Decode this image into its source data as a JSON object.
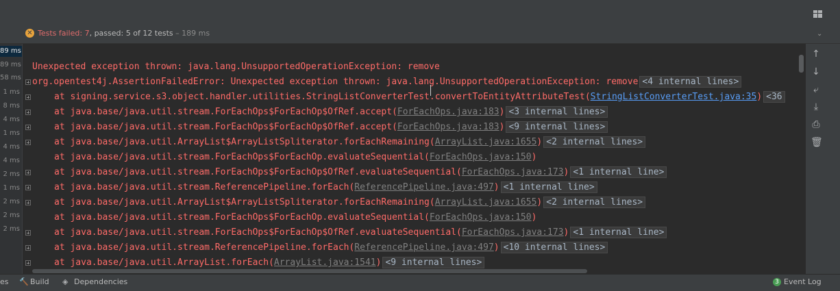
{
  "status": {
    "failed_label": "Tests failed: 7",
    "passed_label": ", passed: 5",
    "total_label": " of 12 tests",
    "time_label": " – 189 ms"
  },
  "durations": [
    "89 ms",
    "89 ms",
    "58 ms",
    "1 ms",
    "8 ms",
    "4 ms",
    "1 ms",
    "4 ms",
    "4 ms",
    "2 ms",
    "1 ms",
    "2 ms",
    "2 ms",
    "2 ms"
  ],
  "console": {
    "lines": [
      {
        "expander": false,
        "indent": false,
        "text": "Unexpected exception thrown: java.lang.UnsupportedOperationException: remove",
        "link": "",
        "after": "",
        "fold": ""
      },
      {
        "expander": true,
        "indent": false,
        "text": "org.opentest4j.AssertionFailedError: Unexpected exception thrown: java.lang.UnsupportedOperationException: remove",
        "link": "",
        "after": "",
        "fold": "<4 internal lines>"
      },
      {
        "expander": true,
        "indent": true,
        "text": "at signing.service.s3.object.handler.utilities.StringListConverterTest.convertToEntityAttributeTest(",
        "link": "StringListConverterTest.java:35",
        "linkBlue": true,
        "after": ")",
        "fold": "<36"
      },
      {
        "expander": true,
        "indent": true,
        "text": "at java.base/java.util.stream.ForEachOps$ForEachOp$OfRef.accept(",
        "link": "ForEachOps.java:183",
        "after": ")",
        "fold": "<3 internal lines>"
      },
      {
        "expander": true,
        "indent": true,
        "text": "at java.base/java.util.stream.ForEachOps$ForEachOp$OfRef.accept(",
        "link": "ForEachOps.java:183",
        "after": ")",
        "fold": "<9 internal lines>"
      },
      {
        "expander": true,
        "indent": true,
        "text": "at java.base/java.util.ArrayList$ArrayListSpliterator.forEachRemaining(",
        "link": "ArrayList.java:1655",
        "after": ")",
        "fold": "<2 internal lines>"
      },
      {
        "expander": false,
        "indent": true,
        "text": "at java.base/java.util.stream.ForEachOps$ForEachOp.evaluateSequential(",
        "link": "ForEachOps.java:150",
        "after": ")",
        "fold": ""
      },
      {
        "expander": true,
        "indent": true,
        "text": "at java.base/java.util.stream.ForEachOps$ForEachOp$OfRef.evaluateSequential(",
        "link": "ForEachOps.java:173",
        "after": ")",
        "fold": "<1 internal line>"
      },
      {
        "expander": true,
        "indent": true,
        "text": "at java.base/java.util.stream.ReferencePipeline.forEach(",
        "link": "ReferencePipeline.java:497",
        "after": ")",
        "fold": "<1 internal line>"
      },
      {
        "expander": true,
        "indent": true,
        "text": "at java.base/java.util.ArrayList$ArrayListSpliterator.forEachRemaining(",
        "link": "ArrayList.java:1655",
        "after": ")",
        "fold": "<2 internal lines>"
      },
      {
        "expander": false,
        "indent": true,
        "text": "at java.base/java.util.stream.ForEachOps$ForEachOp.evaluateSequential(",
        "link": "ForEachOps.java:150",
        "after": ")",
        "fold": ""
      },
      {
        "expander": true,
        "indent": true,
        "text": "at java.base/java.util.stream.ForEachOps$ForEachOp$OfRef.evaluateSequential(",
        "link": "ForEachOps.java:173",
        "after": ")",
        "fold": "<1 internal line>"
      },
      {
        "expander": true,
        "indent": true,
        "text": "at java.base/java.util.stream.ReferencePipeline.forEach(",
        "link": "ReferencePipeline.java:497",
        "after": ")",
        "fold": "<10 internal lines>"
      },
      {
        "expander": true,
        "indent": true,
        "text": "at java.base/java.util.ArrayList.forEach(",
        "link": "ArrayList.java:1541",
        "after": ")",
        "fold": "<9 internal lines>"
      }
    ]
  },
  "toolbar": {
    "icons": [
      "arrow-up-icon",
      "arrow-down-icon",
      "soft-wrap-icon",
      "scroll-to-end-icon",
      "print-icon",
      "trash-icon"
    ]
  },
  "bottom": {
    "tab_partial": "es",
    "build": "Build",
    "dependencies": "Dependencies",
    "event_log": "Event Log",
    "event_count": "3"
  },
  "colors": {
    "error_text": "#ff6b68",
    "link": "#589df6",
    "background": "#2b2b2b",
    "panel": "#3c3f41"
  }
}
